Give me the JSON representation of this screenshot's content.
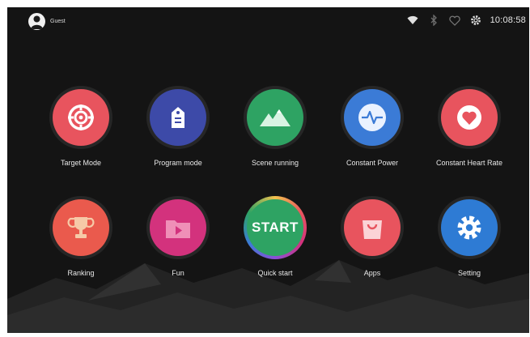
{
  "status": {
    "user_name": "Guest",
    "time": "10:08:58",
    "icons": [
      "wifi-icon",
      "bluetooth-icon",
      "heart-rate-icon",
      "settings-gear-icon"
    ]
  },
  "tiles": [
    {
      "label": "Target Mode",
      "icon": "target-icon",
      "color": "#e8545e"
    },
    {
      "label": "Program mode",
      "icon": "program-tag-icon",
      "color": "#3d4aa8"
    },
    {
      "label": "Scene running",
      "icon": "mountain-icon",
      "color": "#2ea363"
    },
    {
      "label": "Constant Power",
      "icon": "pulse-icon",
      "color": "#3b7bd6"
    },
    {
      "label": "Constant Heart Rate",
      "icon": "heart-icon",
      "color": "#e8545e"
    },
    {
      "label": "Ranking",
      "icon": "trophy-icon",
      "color": "#ea5a4d"
    },
    {
      "label": "Fun",
      "icon": "play-folder-icon",
      "color": "#d3327d"
    },
    {
      "label": "Quick start",
      "icon": "start-badge",
      "text": "START",
      "color": "#2ea363"
    },
    {
      "label": "Apps",
      "icon": "shopping-bag-icon",
      "color": "#e8545e"
    },
    {
      "label": "Setting",
      "icon": "gear-icon",
      "color": "#2e7bd4"
    }
  ]
}
